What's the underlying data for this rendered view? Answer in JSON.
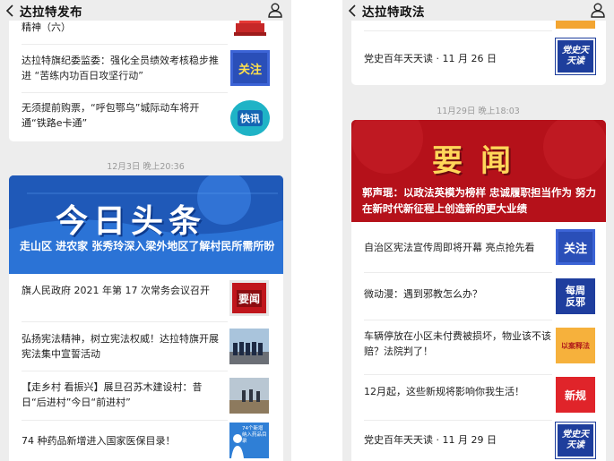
{
  "left": {
    "title": "达拉特发布",
    "top_items": [
      {
        "title": "精神（六）"
      },
      {
        "title": "达拉特旗纪委监委：强化全员绩效考核稳步推进 “苦练内功百日攻坚行动”",
        "thumb_label": "关注"
      },
      {
        "title": "无须提前购票，“呼包鄂乌”城际动车将开通“铁路e卡通”",
        "thumb_label": "快讯"
      }
    ],
    "timestamp": "12月3日 晚上20:36",
    "headline_banner": "今日头条",
    "headline": "走山区 进农家 张秀玲深入梁外地区了解村民所需所盼",
    "items": [
      {
        "title": "旗人民政府 2021 年第 17 次常务会议召开",
        "thumb_label": "要闻"
      },
      {
        "title": "弘扬宪法精神，树立宪法权威！达拉特旗开展宪法集中宣誓活动"
      },
      {
        "title": "【走乡村 看振兴】展旦召苏木建设村：昔日“后进村”今日“前进村”"
      },
      {
        "title": "74 种药品新增进入国家医保目录！",
        "thumb_label": "74个新增纳入药品目录"
      }
    ]
  },
  "right": {
    "title": "达拉特政法",
    "top_items": [
      {
        "title": "党史百年天天读 · 11 月 26 日",
        "thumb_label": "党史天天读"
      }
    ],
    "timestamp": "11月29日 晚上18:03",
    "headline_banner": "要闻",
    "headline": "郭声琨：以政法英模为榜样 忠诚履职担当作为 努力在新时代新征程上创造新的更大业绩",
    "items": [
      {
        "title": "自治区宪法宣传周即将开幕 亮点抢先看",
        "thumb_label": "关注"
      },
      {
        "title": "微动漫：遇到邪教怎么办？",
        "thumb_label": "每周反邪"
      },
      {
        "title": "车辆停放在小区未付费被损坏，物业该不该赔？法院判了！",
        "thumb_label": "以案释法"
      },
      {
        "title": "12月起，这些新规将影响你我生活！",
        "thumb_label": "新规"
      },
      {
        "title": "党史百年天天读 · 11 月 29 日",
        "thumb_label": "党史天天读"
      }
    ]
  },
  "colors": {
    "background": "#ededed",
    "card": "#ffffff",
    "left_banner": "#1f59b8",
    "right_banner": "#b5111a",
    "banner_text": "#ffd65a"
  }
}
